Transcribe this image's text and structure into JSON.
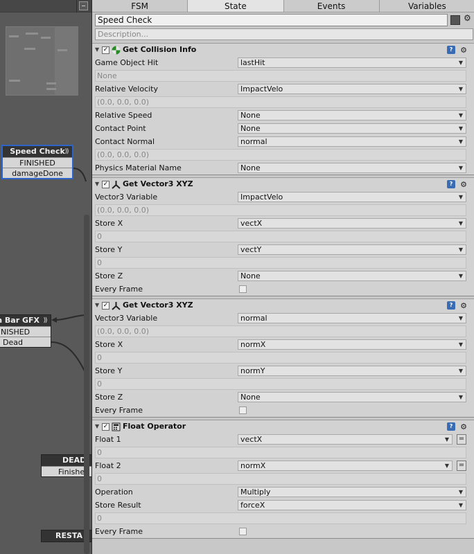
{
  "graph": {
    "speed_node": {
      "title": "Speed Check",
      "rows": [
        "FINISHED",
        "damageDone"
      ]
    },
    "health_node": {
      "title": "th Bar GFX",
      "rows": [
        "NISHED",
        "Dead"
      ]
    },
    "dead_node": {
      "title": "DEAD",
      "rows": [
        "Finishe"
      ]
    },
    "restart_node": {
      "title": "RESTA"
    }
  },
  "tabs": [
    {
      "label": "FSM",
      "active": false
    },
    {
      "label": "State",
      "active": true
    },
    {
      "label": "Events",
      "active": false
    },
    {
      "label": "Variables",
      "active": false
    }
  ],
  "state": {
    "name": "Speed Check",
    "description_placeholder": "Description...",
    "color": "#555555"
  },
  "actions": [
    {
      "title": "Get Collision Info",
      "icon": "collision-icon",
      "enabled": true,
      "rows": [
        {
          "type": "prop",
          "label": "Game Object Hit",
          "value": "lastHit"
        },
        {
          "type": "val",
          "value": "None"
        },
        {
          "type": "prop",
          "label": "Relative Velocity",
          "value": "ImpactVelo"
        },
        {
          "type": "val",
          "value": "(0.0, 0.0, 0.0)"
        },
        {
          "type": "prop",
          "label": "Relative Speed",
          "value": "None"
        },
        {
          "type": "prop",
          "label": "Contact Point",
          "value": "None"
        },
        {
          "type": "prop",
          "label": "Contact Normal",
          "value": "normal"
        },
        {
          "type": "val",
          "value": "(0.0, 0.0, 0.0)"
        },
        {
          "type": "prop",
          "label": "Physics Material Name",
          "value": "None"
        }
      ]
    },
    {
      "title": "Get Vector3 XYZ",
      "icon": "vector-axes-icon",
      "enabled": true,
      "rows": [
        {
          "type": "prop",
          "label": "Vector3 Variable",
          "value": "ImpactVelo"
        },
        {
          "type": "val",
          "value": "(0.0, 0.0, 0.0)"
        },
        {
          "type": "prop",
          "label": "Store X",
          "value": "vectX"
        },
        {
          "type": "val",
          "value": "0"
        },
        {
          "type": "prop",
          "label": "Store Y",
          "value": "vectY"
        },
        {
          "type": "val",
          "value": "0"
        },
        {
          "type": "prop",
          "label": "Store Z",
          "value": "None"
        },
        {
          "type": "check",
          "label": "Every Frame",
          "checked": false
        }
      ]
    },
    {
      "title": "Get Vector3 XYZ",
      "icon": "vector-axes-icon",
      "enabled": true,
      "rows": [
        {
          "type": "prop",
          "label": "Vector3 Variable",
          "value": "normal"
        },
        {
          "type": "val",
          "value": "(0.0, 0.0, 0.0)"
        },
        {
          "type": "prop",
          "label": "Store X",
          "value": "normX"
        },
        {
          "type": "val",
          "value": "0"
        },
        {
          "type": "prop",
          "label": "Store Y",
          "value": "normY"
        },
        {
          "type": "val",
          "value": "0"
        },
        {
          "type": "prop",
          "label": "Store Z",
          "value": "None"
        },
        {
          "type": "check",
          "label": "Every Frame",
          "checked": false
        }
      ]
    },
    {
      "title": "Float Operator",
      "icon": "calculator-icon",
      "enabled": true,
      "rows": [
        {
          "type": "prop",
          "label": "Float 1",
          "value": "vectX",
          "eq": true
        },
        {
          "type": "val",
          "value": "0"
        },
        {
          "type": "prop",
          "label": "Float 2",
          "value": "normX",
          "eq": true
        },
        {
          "type": "val",
          "value": "0"
        },
        {
          "type": "prop",
          "label": "Operation",
          "value": "Multiply"
        },
        {
          "type": "prop",
          "label": "Store Result",
          "value": "forceX"
        },
        {
          "type": "val",
          "value": "0"
        },
        {
          "type": "check",
          "label": "Every Frame",
          "checked": false
        }
      ]
    }
  ]
}
